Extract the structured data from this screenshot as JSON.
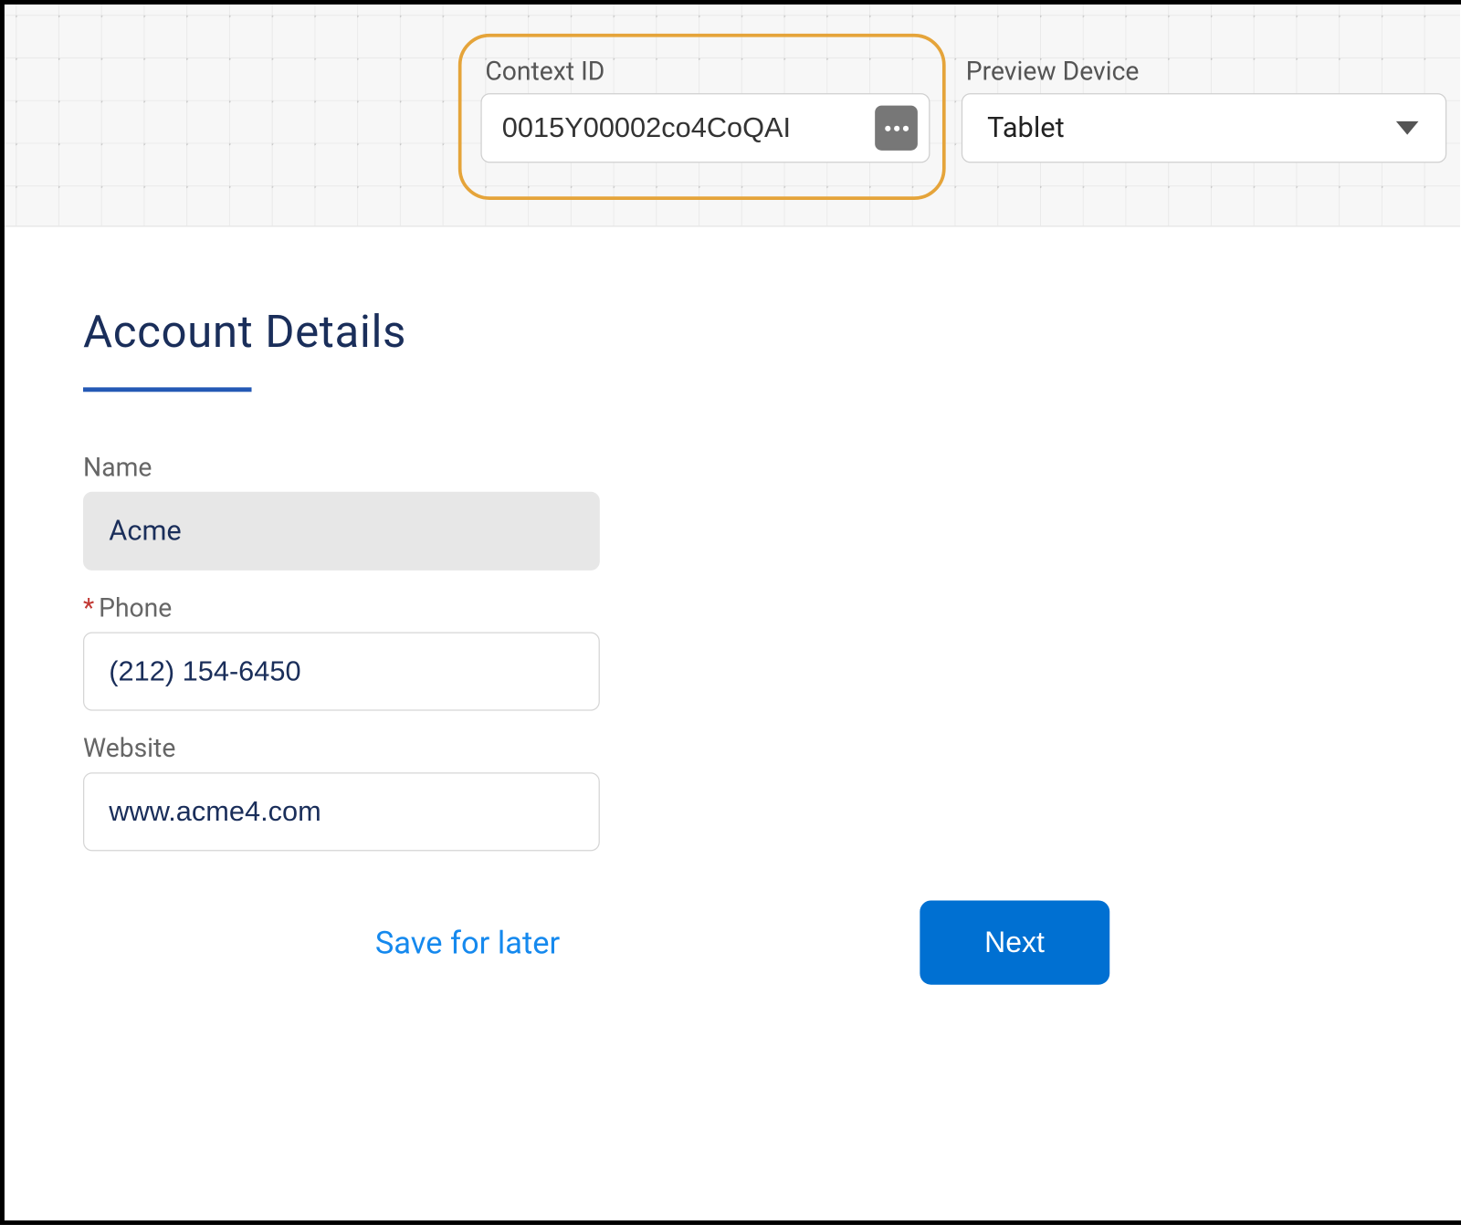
{
  "toolbar": {
    "context_id": {
      "label": "Context ID",
      "value": "0015Y00002co4CoQAI"
    },
    "preview_device": {
      "label": "Preview Device",
      "value": "Tablet"
    }
  },
  "page": {
    "title": "Account Details"
  },
  "form": {
    "name": {
      "label": "Name",
      "value": "Acme",
      "readonly": true
    },
    "phone": {
      "label": "Phone",
      "value": "(212) 154-6450",
      "required": true
    },
    "website": {
      "label": "Website",
      "value": "www.acme4.com"
    }
  },
  "actions": {
    "save_for_later": "Save for later",
    "next": "Next"
  }
}
